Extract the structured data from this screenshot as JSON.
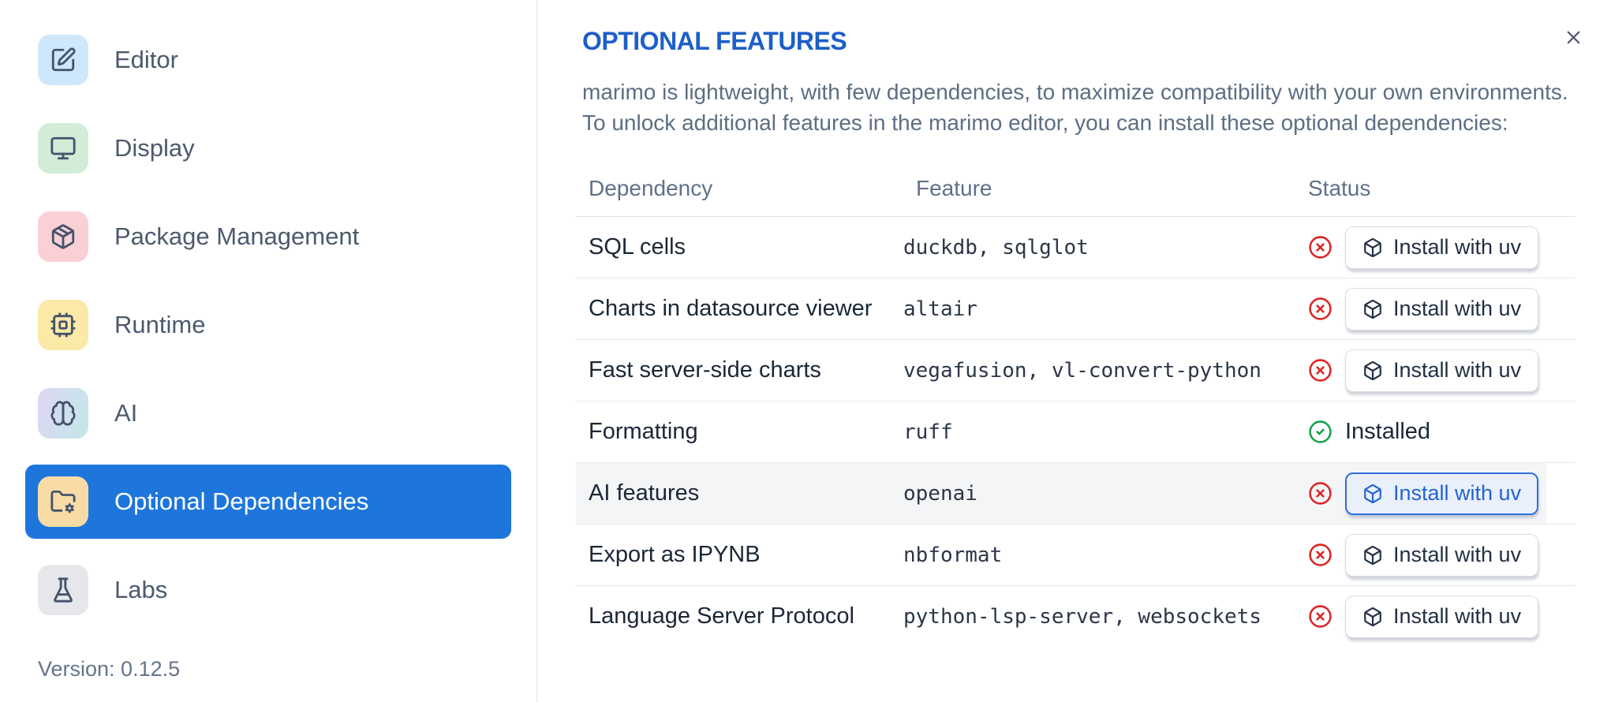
{
  "sidebar": {
    "items": [
      {
        "label": "Editor",
        "icon": "edit-pencil-icon",
        "icon_bg": "#cfe7fb",
        "selected": false
      },
      {
        "label": "Display",
        "icon": "monitor-icon",
        "icon_bg": "#d2ecd7",
        "selected": false
      },
      {
        "label": "Package Management",
        "icon": "package-icon",
        "icon_bg": "#fad0d5",
        "selected": false
      },
      {
        "label": "Runtime",
        "icon": "cpu-icon",
        "icon_bg": "#fbe9a8",
        "selected": false
      },
      {
        "label": "AI",
        "icon": "brain-icon",
        "icon_bg": "linear-gradient(105deg,#ded5f3 0%,#cfe0ee 55%,#c4e7e5 100%)",
        "selected": false
      },
      {
        "label": "Optional Dependencies",
        "icon": "folder-gear-icon",
        "icon_bg": "#f9dba6",
        "selected": true
      },
      {
        "label": "Labs",
        "icon": "flask-icon",
        "icon_bg": "#e5e7ea",
        "selected": false
      }
    ],
    "version": "Version: 0.12.5"
  },
  "main": {
    "title": "OPTIONAL FEATURES",
    "description_lines": [
      "marimo is lightweight, with few dependencies, to maximize compatibility with your own environments.",
      "To unlock additional features in the marimo editor, you can install these optional dependencies:"
    ],
    "close_icon": "close-icon",
    "table": {
      "headers": [
        "Dependency",
        "Feature",
        "Status"
      ],
      "rows": [
        {
          "dependency": "SQL cells",
          "feature": "duckdb, sqlglot",
          "installed": false,
          "action_label": "Install with uv",
          "highlighted": false
        },
        {
          "dependency": "Charts in datasource viewer",
          "feature": "altair",
          "installed": false,
          "action_label": "Install with uv",
          "highlighted": false
        },
        {
          "dependency": "Fast server-side charts",
          "feature": "vegafusion, vl-convert-python",
          "installed": false,
          "action_label": "Install with uv",
          "highlighted": false
        },
        {
          "dependency": "Formatting",
          "feature": "ruff",
          "installed": true,
          "status_label": "Installed",
          "highlighted": false
        },
        {
          "dependency": "AI features",
          "feature": "openai",
          "installed": false,
          "action_label": "Install with uv",
          "highlighted": true
        },
        {
          "dependency": "Export as IPYNB",
          "feature": "nbformat",
          "installed": false,
          "action_label": "Install with uv",
          "highlighted": false
        },
        {
          "dependency": "Language Server Protocol",
          "feature": "python-lsp-server, websockets",
          "installed": false,
          "action_label": "Install with uv",
          "highlighted": false
        }
      ]
    }
  },
  "colors": {
    "selected_item_bg": "#1e76dd",
    "title_blue": "#1d5fc8",
    "status_missing_red": "#dc2626",
    "status_installed_green": "#16a34a",
    "accent_button_border": "#2f6fdd",
    "accent_button_bg": "#e9f0fc"
  }
}
